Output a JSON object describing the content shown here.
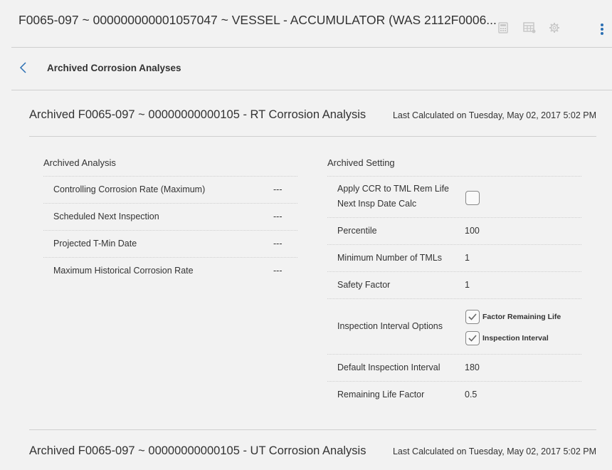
{
  "header": {
    "title": "F0065-097 ~ 000000000001057047 ~ VESSEL - ACCUMULATOR (WAS 2112F0006...",
    "icons": [
      "calculator-icon",
      "table-icon",
      "gear-icon",
      "more-vertical-icon"
    ]
  },
  "breadcrumb": {
    "back_icon": "chevron-left-icon",
    "label": "Archived Corrosion Analyses"
  },
  "analyses": [
    {
      "title": "Archived F0065-097 ~ 00000000000105 - RT Corrosion Analysis",
      "last_calculated": "Last Calculated on Tuesday, May 02, 2017 5:02 PM",
      "archived_analysis": {
        "heading": "Archived Analysis",
        "rows": [
          {
            "label": "Controlling Corrosion Rate (Maximum)",
            "value": "---"
          },
          {
            "label": "Scheduled Next Inspection",
            "value": "---"
          },
          {
            "label": "Projected T-Min Date",
            "value": "---"
          },
          {
            "label": "Maximum Historical Corrosion Rate",
            "value": "---"
          }
        ]
      },
      "archived_setting": {
        "heading": "Archived Setting",
        "apply_ccr": {
          "label_line1": "Apply CCR to TML Rem Life",
          "label_line2": "Next Insp Date Calc",
          "checked": false
        },
        "percentile": {
          "label": "Percentile",
          "value": "100"
        },
        "min_tmls": {
          "label": "Minimum Number of TMLs",
          "value": "1"
        },
        "safety_factor": {
          "label": "Safety Factor",
          "value": "1"
        },
        "interval_options": {
          "label": "Inspection Interval Options",
          "options": [
            {
              "label": "Factor Remaining Life",
              "checked": true
            },
            {
              "label": "Inspection Interval",
              "checked": true
            }
          ]
        },
        "default_interval": {
          "label": "Default Inspection Interval",
          "value": "180"
        },
        "remaining_life_factor": {
          "label": "Remaining Life Factor",
          "value": "0.5"
        }
      }
    },
    {
      "title": "Archived F0065-097 ~ 00000000000105 - UT Corrosion Analysis",
      "last_calculated": "Last Calculated on Tuesday, May 02, 2017 5:02 PM"
    }
  ],
  "colors": {
    "accent": "#2b6fb3",
    "icon_gray": "#c8c8c8",
    "divider": "#cfcfcf",
    "background": "#f2f2f2"
  }
}
